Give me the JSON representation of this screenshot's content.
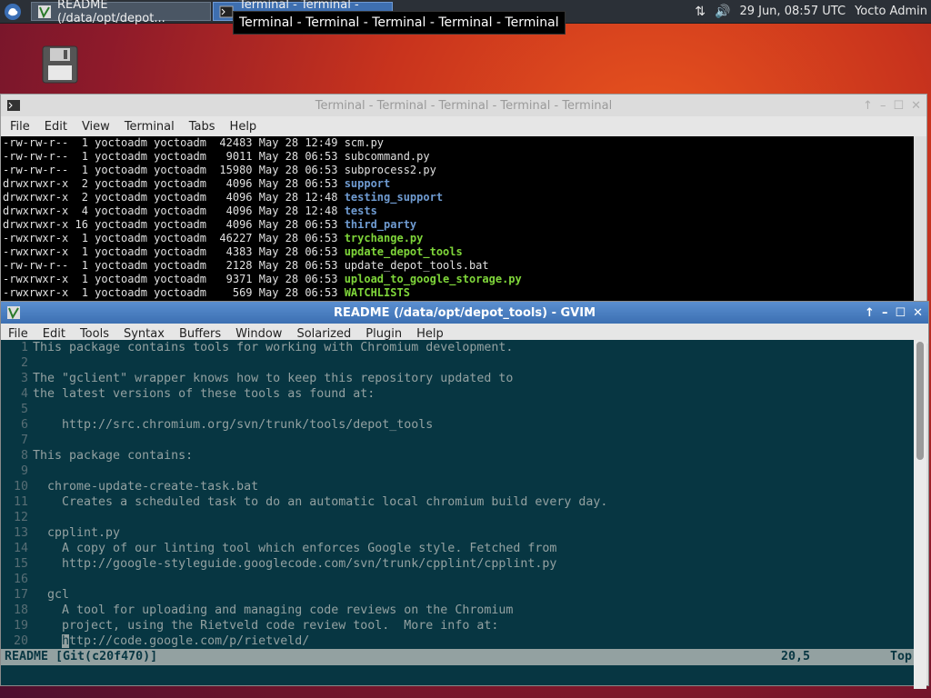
{
  "panel": {
    "tasks": [
      {
        "label": "README (/data/opt/depot..."
      },
      {
        "label": "Terminal - Terminal - Termi..."
      }
    ],
    "tooltip": "Terminal - Terminal - Terminal - Terminal - Terminal",
    "clock": "29 Jun, 08:57 UTC",
    "user": "Yocto Admin"
  },
  "terminal": {
    "title": "Terminal - Terminal - Terminal - Terminal - Terminal",
    "menu": [
      "File",
      "Edit",
      "View",
      "Terminal",
      "Tabs",
      "Help"
    ],
    "lines": [
      {
        "meta": "-rw-rw-r--  1 yoctoadm yoctoadm  42483 May 28 12:49 ",
        "name": "scm.py",
        "kind": "file"
      },
      {
        "meta": "-rw-rw-r--  1 yoctoadm yoctoadm   9011 May 28 06:53 ",
        "name": "subcommand.py",
        "kind": "file"
      },
      {
        "meta": "-rw-rw-r--  1 yoctoadm yoctoadm  15980 May 28 06:53 ",
        "name": "subprocess2.py",
        "kind": "file"
      },
      {
        "meta": "drwxrwxr-x  2 yoctoadm yoctoadm   4096 May 28 06:53 ",
        "name": "support",
        "kind": "dir"
      },
      {
        "meta": "drwxrwxr-x  2 yoctoadm yoctoadm   4096 May 28 12:48 ",
        "name": "testing_support",
        "kind": "dir"
      },
      {
        "meta": "drwxrwxr-x  4 yoctoadm yoctoadm   4096 May 28 12:48 ",
        "name": "tests",
        "kind": "dir"
      },
      {
        "meta": "drwxrwxr-x 16 yoctoadm yoctoadm   4096 May 28 06:53 ",
        "name": "third_party",
        "kind": "dir"
      },
      {
        "meta": "-rwxrwxr-x  1 yoctoadm yoctoadm  46227 May 28 06:53 ",
        "name": "trychange.py",
        "kind": "exe"
      },
      {
        "meta": "-rwxrwxr-x  1 yoctoadm yoctoadm   4383 May 28 06:53 ",
        "name": "update_depot_tools",
        "kind": "exe"
      },
      {
        "meta": "-rw-rw-r--  1 yoctoadm yoctoadm   2128 May 28 06:53 ",
        "name": "update_depot_tools.bat",
        "kind": "file"
      },
      {
        "meta": "-rwxrwxr-x  1 yoctoadm yoctoadm   9371 May 28 06:53 ",
        "name": "upload_to_google_storage.py",
        "kind": "exe"
      },
      {
        "meta": "-rwxrwxr-x  1 yoctoadm yoctoadm    569 May 28 06:53 ",
        "name": "WATCHLISTS",
        "kind": "exe"
      }
    ]
  },
  "gvim": {
    "title": "README (/data/opt/depot_tools) - GVIM",
    "menu": [
      "File",
      "Edit",
      "Tools",
      "Syntax",
      "Buffers",
      "Window",
      "Solarized",
      "Plugin",
      "Help"
    ],
    "lines": [
      "This package contains tools for working with Chromium development.",
      "",
      "The \"gclient\" wrapper knows how to keep this repository updated to",
      "the latest versions of these tools as found at:",
      "",
      "    http://src.chromium.org/svn/trunk/tools/depot_tools",
      "",
      "This package contains:",
      "",
      "  chrome-update-create-task.bat",
      "    Creates a scheduled task to do an automatic local chromium build every day.",
      "",
      "  cpplint.py",
      "    A copy of our linting tool which enforces Google style. Fetched from",
      "    http://google-styleguide.googlecode.com/svn/trunk/cpplint/cpplint.py",
      "",
      "  gcl",
      "    A tool for uploading and managing code reviews on the Chromium",
      "    project, using the Rietveld code review tool.  More info at:",
      "    http://code.google.com/p/rietveld/"
    ],
    "status": {
      "file": "README [Git(c20f470)]",
      "position": "20,5",
      "percent": "Top"
    }
  },
  "colors": {
    "vim_bg": "#073642",
    "vim_fg": "#93a1a1",
    "term_dir": "#6f9bd1",
    "term_exe": "#7fd63a"
  }
}
